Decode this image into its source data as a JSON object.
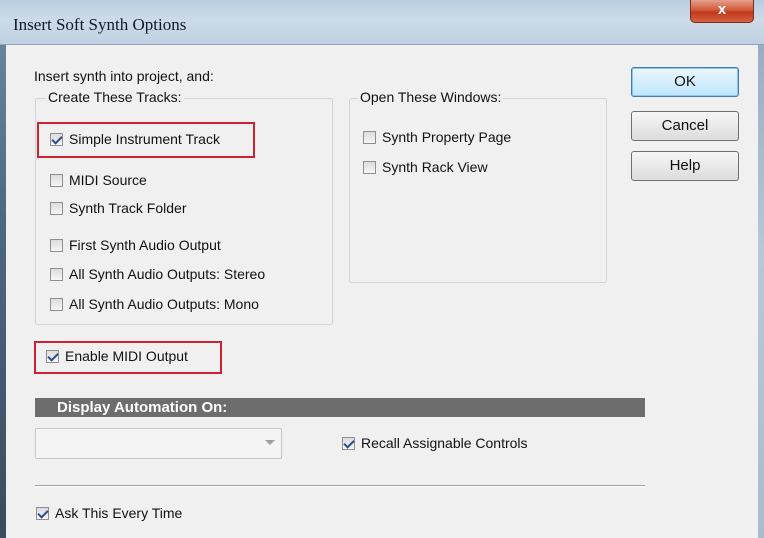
{
  "window": {
    "title": "Insert Soft Synth Options",
    "close_label": "x"
  },
  "intro": "Insert synth into project, and:",
  "tracks_group": {
    "label": "Create These Tracks:",
    "items": [
      {
        "label": "Simple Instrument Track",
        "checked": true
      },
      {
        "label": "MIDI Source",
        "checked": false
      },
      {
        "label": "Synth Track Folder",
        "checked": false
      },
      {
        "label": "First Synth Audio Output",
        "checked": false
      },
      {
        "label": "All Synth Audio Outputs: Stereo",
        "checked": false
      },
      {
        "label": "All Synth Audio Outputs: Mono",
        "checked": false
      }
    ]
  },
  "windows_group": {
    "label": "Open These Windows:",
    "items": [
      {
        "label": "Synth Property Page",
        "checked": false
      },
      {
        "label": "Synth Rack View",
        "checked": false
      }
    ]
  },
  "enable_midi": {
    "label": "Enable MIDI Output",
    "checked": true
  },
  "automation": {
    "header": "Display Automation On:",
    "combo_value": "",
    "recall": {
      "label": "Recall Assignable Controls",
      "checked": true
    }
  },
  "ask_every_time": {
    "label": "Ask This Every Time",
    "checked": true
  },
  "buttons": {
    "ok": "OK",
    "cancel": "Cancel",
    "help": "Help"
  },
  "colors": {
    "highlight": "#cc2233",
    "section_bar": "#6d6d6d",
    "dialog_bg": "#f0f0f0"
  }
}
